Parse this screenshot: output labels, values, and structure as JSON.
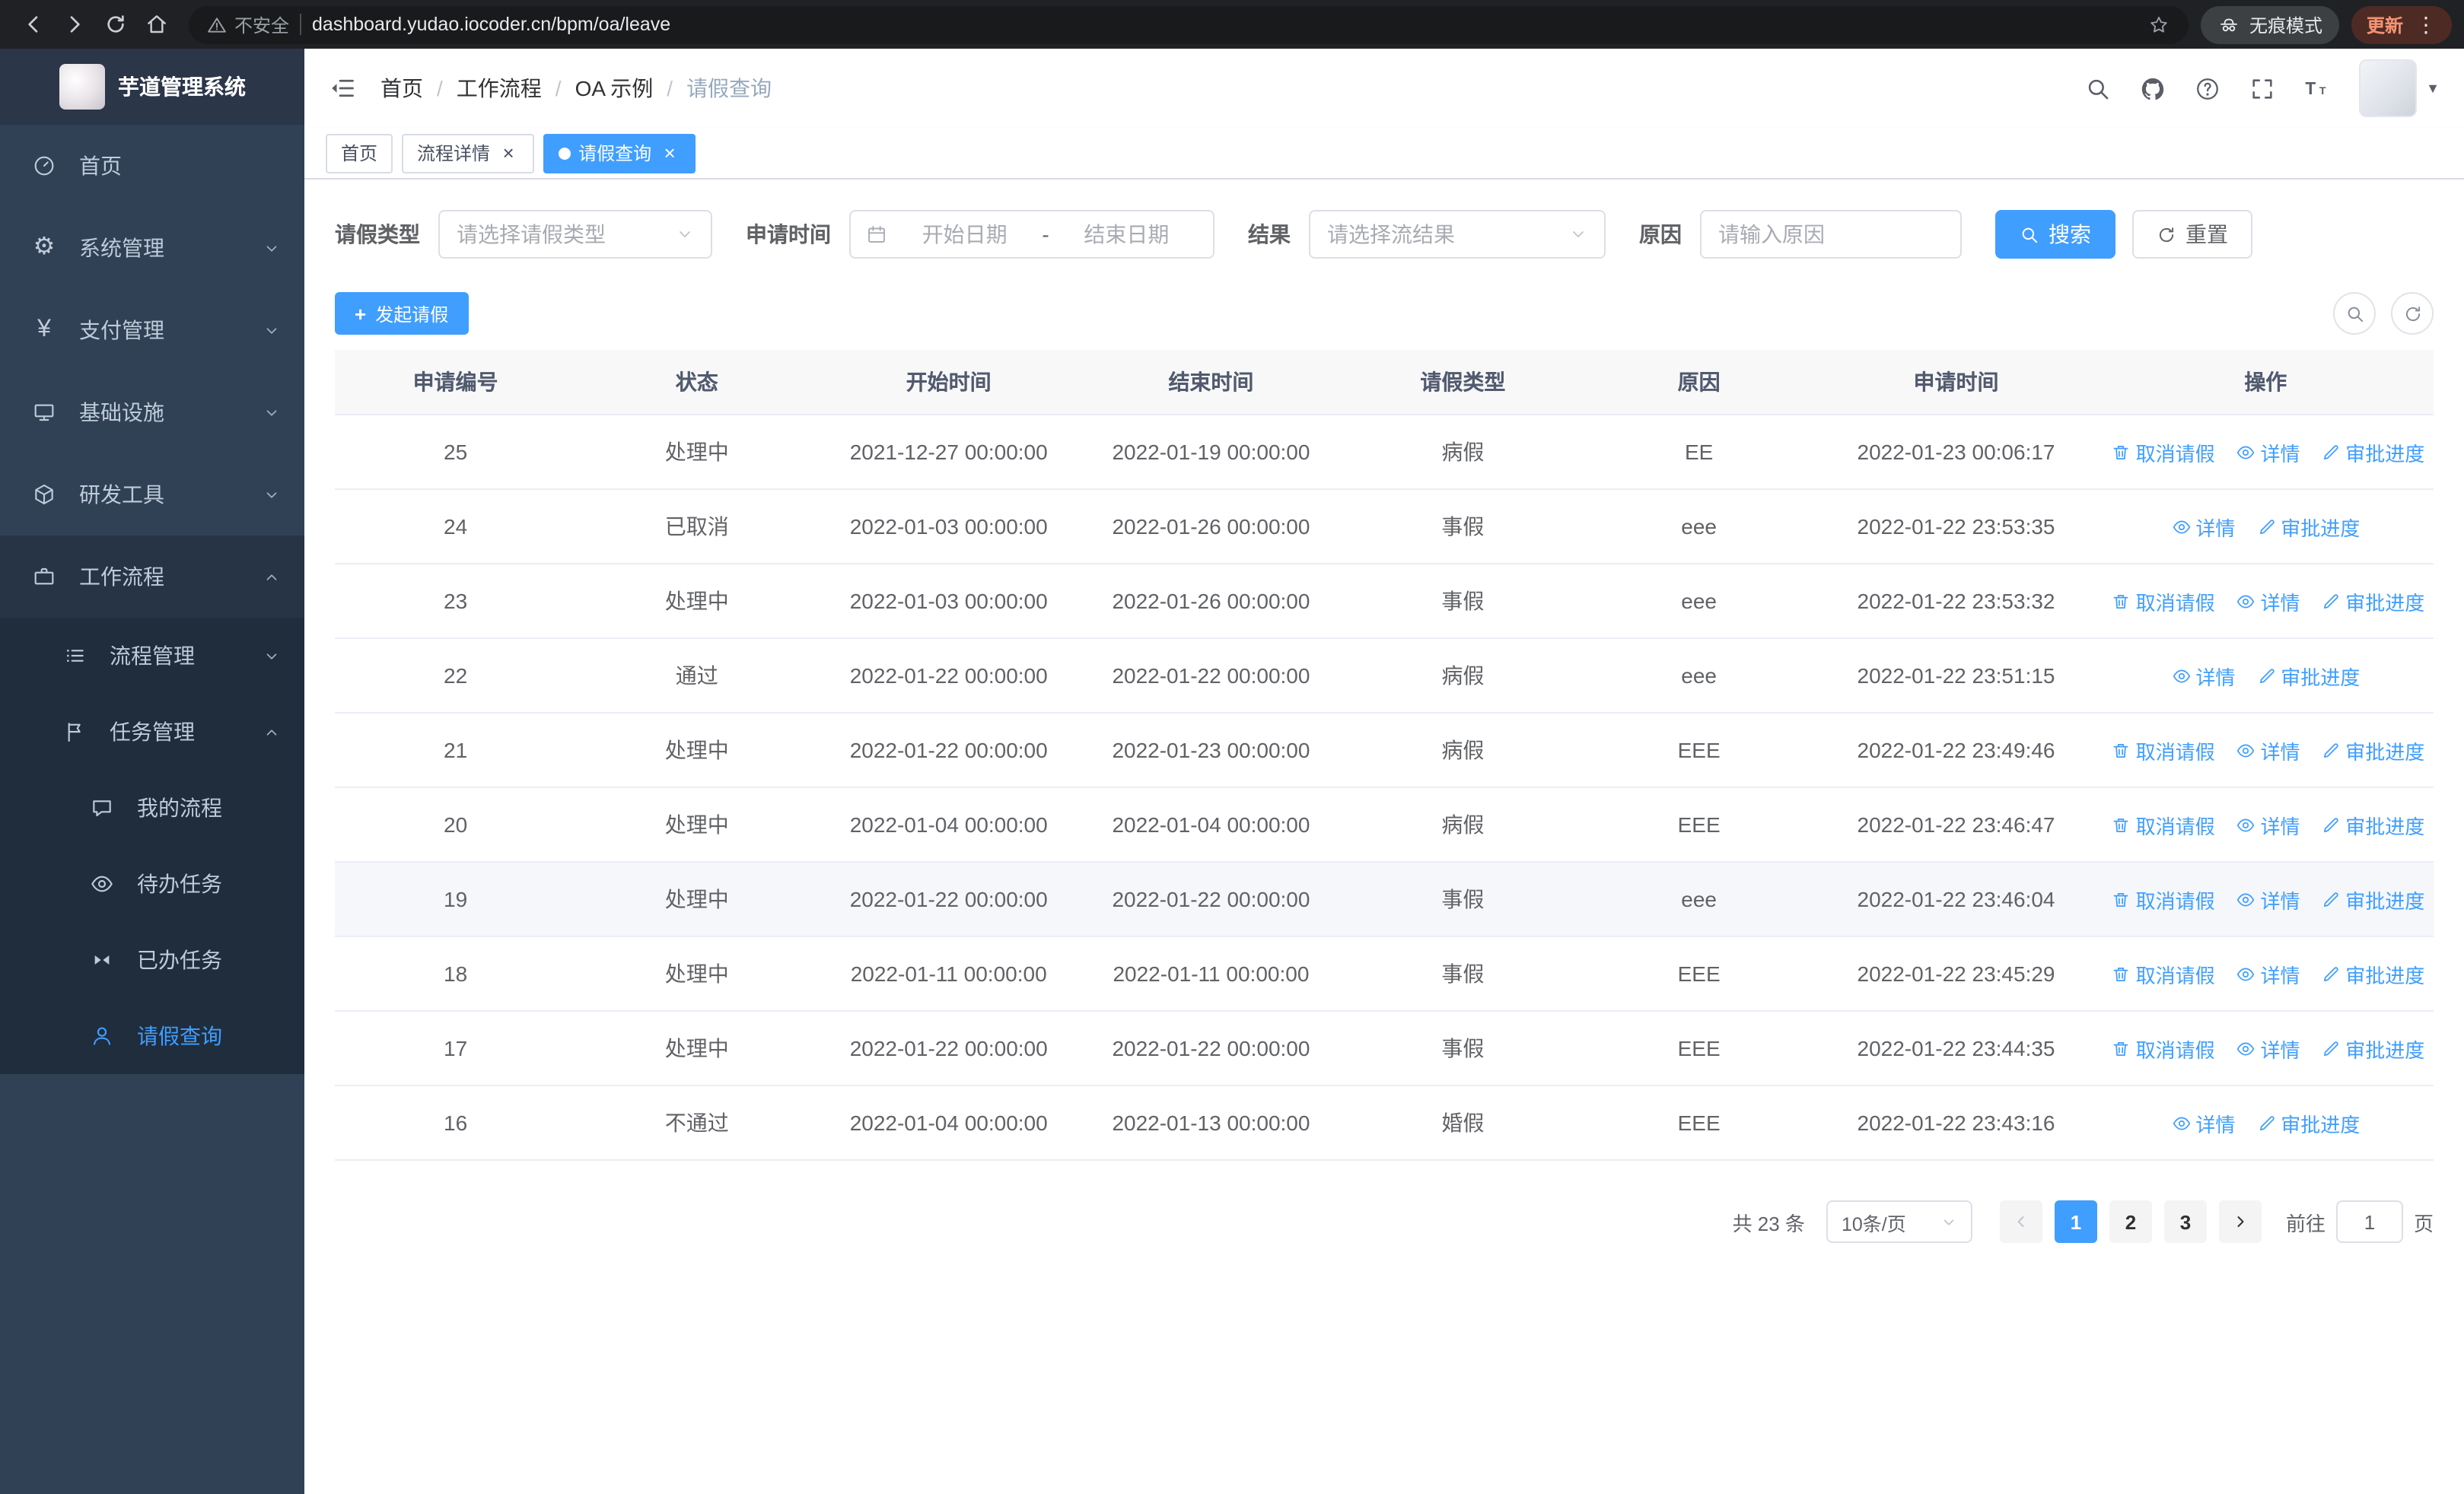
{
  "colors": {
    "primary": "#409eff",
    "sidebar_bg": "#304156",
    "submenu_bg": "#1f2d3d",
    "active_tag_bg": "#409eff"
  },
  "glyphs": {
    "gear": "⚙",
    "yen": "¥",
    "caret_down": "▼",
    "close": "×",
    "plus": "+",
    "menu_dots": "⋮"
  },
  "browser": {
    "security_label": "不安全",
    "url": "dashboard.yudao.iocoder.cn/bpm/oa/leave",
    "incognito_label": "无痕模式",
    "update_label": "更新"
  },
  "sidebar": {
    "logo_title": "芋道管理系统",
    "menu": [
      {
        "label": "首页"
      },
      {
        "label": "系统管理"
      },
      {
        "label": "支付管理"
      },
      {
        "label": "基础设施"
      },
      {
        "label": "研发工具"
      },
      {
        "label": "工作流程"
      },
      {
        "label": "流程管理"
      },
      {
        "label": "任务管理"
      },
      {
        "label": "我的流程"
      },
      {
        "label": "待办任务"
      },
      {
        "label": "已办任务"
      },
      {
        "label": "请假查询"
      }
    ]
  },
  "header": {
    "breadcrumb": [
      "首页",
      "工作流程",
      "OA 示例",
      "请假查询"
    ],
    "separator": "/"
  },
  "tabs": [
    {
      "label": "首页"
    },
    {
      "label": "流程详情"
    },
    {
      "label": "请假查询"
    }
  ],
  "filters": {
    "leave_type_label": "请假类型",
    "leave_type_placeholder": "请选择请假类型",
    "apply_time_label": "申请时间",
    "start_placeholder": "开始日期",
    "range_separator": "-",
    "end_placeholder": "结束日期",
    "result_label": "结果",
    "result_placeholder": "请选择流结果",
    "reason_label": "原因",
    "reason_placeholder": "请输入原因",
    "search_label": "搜索",
    "reset_label": "重置"
  },
  "actions": {
    "create_label": "发起请假"
  },
  "table": {
    "columns": [
      "申请编号",
      "状态",
      "开始时间",
      "结束时间",
      "请假类型",
      "原因",
      "申请时间",
      "操作"
    ],
    "ops": {
      "cancel": "取消请假",
      "detail": "详情",
      "progress": "审批进度"
    },
    "rows": [
      {
        "id": "25",
        "status": "处理中",
        "start_time": "2021-12-27 00:00:00",
        "end_time": "2022-01-19 00:00:00",
        "leave_type": "病假",
        "reason": "EE",
        "apply_time": "2022-01-23 00:06:17"
      },
      {
        "id": "24",
        "status": "已取消",
        "start_time": "2022-01-03 00:00:00",
        "end_time": "2022-01-26 00:00:00",
        "leave_type": "事假",
        "reason": "eee",
        "apply_time": "2022-01-22 23:53:35"
      },
      {
        "id": "23",
        "status": "处理中",
        "start_time": "2022-01-03 00:00:00",
        "end_time": "2022-01-26 00:00:00",
        "leave_type": "事假",
        "reason": "eee",
        "apply_time": "2022-01-22 23:53:32"
      },
      {
        "id": "22",
        "status": "通过",
        "start_time": "2022-01-22 00:00:00",
        "end_time": "2022-01-22 00:00:00",
        "leave_type": "病假",
        "reason": "eee",
        "apply_time": "2022-01-22 23:51:15"
      },
      {
        "id": "21",
        "status": "处理中",
        "start_time": "2022-01-22 00:00:00",
        "end_time": "2022-01-23 00:00:00",
        "leave_type": "病假",
        "reason": "EEE",
        "apply_time": "2022-01-22 23:49:46"
      },
      {
        "id": "20",
        "status": "处理中",
        "start_time": "2022-01-04 00:00:00",
        "end_time": "2022-01-04 00:00:00",
        "leave_type": "病假",
        "reason": "EEE",
        "apply_time": "2022-01-22 23:46:47"
      },
      {
        "id": "19",
        "status": "处理中",
        "start_time": "2022-01-22 00:00:00",
        "end_time": "2022-01-22 00:00:00",
        "leave_type": "事假",
        "reason": "eee",
        "apply_time": "2022-01-22 23:46:04"
      },
      {
        "id": "18",
        "status": "处理中",
        "start_time": "2022-01-11 00:00:00",
        "end_time": "2022-01-11 00:00:00",
        "leave_type": "事假",
        "reason": "EEE",
        "apply_time": "2022-01-22 23:45:29"
      },
      {
        "id": "17",
        "status": "处理中",
        "start_time": "2022-01-22 00:00:00",
        "end_time": "2022-01-22 00:00:00",
        "leave_type": "事假",
        "reason": "EEE",
        "apply_time": "2022-01-22 23:44:35"
      },
      {
        "id": "16",
        "status": "不通过",
        "start_time": "2022-01-04 00:00:00",
        "end_time": "2022-01-13 00:00:00",
        "leave_type": "婚假",
        "reason": "EEE",
        "apply_time": "2022-01-22 23:43:16"
      }
    ]
  },
  "pagination": {
    "total": "共 23 条",
    "page_size": "10条/页",
    "pages": [
      "1",
      "2",
      "3"
    ],
    "goto_label": "前往",
    "goto_value": "1",
    "unit_label": "页"
  }
}
